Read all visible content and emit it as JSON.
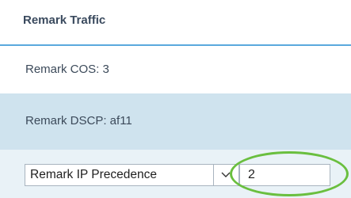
{
  "header": {
    "title": "Remark Traffic"
  },
  "rows": {
    "cos": {
      "label": "Remark COS: 3"
    },
    "dscp": {
      "label": "Remark DSCP: af11"
    }
  },
  "ip_precedence": {
    "select_value": "Remark IP Precedence",
    "input_value": "2"
  },
  "colors": {
    "accent_line": "#5aa9dd",
    "selected_row": "#cfe3ee",
    "highlight": "#6abf3f"
  },
  "icons": {
    "dropdown": "chevron-down-icon"
  }
}
